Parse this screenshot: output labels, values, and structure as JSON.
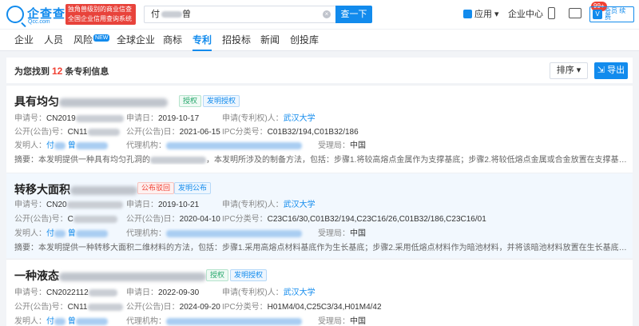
{
  "header": {
    "logo_text": "企查查",
    "logo_sub": "Qcc.com",
    "slogan": "独角兽级别的商业信查 全国企业信用查询系统",
    "search_value": "付",
    "search_value_tail": "曾",
    "search_button": "查一下",
    "app_label": "应用",
    "enterprise_center": "企业中心",
    "msg_badge": "99+",
    "vip_label": "会员 续费"
  },
  "nav": {
    "items": [
      "企业",
      "人员",
      "风险",
      "全球企业",
      "商标",
      "专利",
      "招投标",
      "新闻",
      "创投库"
    ],
    "risk_badge": "NEW",
    "active": "专利"
  },
  "results": {
    "prefix": "为您找到",
    "count": "12",
    "suffix": "条专利信息",
    "sort_label": "排序",
    "export_label": "导出"
  },
  "labels": {
    "app_no": "申请号：",
    "app_date": "申请日：",
    "applicant": "申请(专利权)人：",
    "pub_no": "公开(公告)号：",
    "pub_date": "公开(公告)日：",
    "ipc": "IPC分类号：",
    "inventor": "发明人：",
    "agency": "代理机构：",
    "office": "受理局：",
    "abstract": "摘要："
  },
  "patents": [
    {
      "title": "具有均匀",
      "status_tag": "授权",
      "type_tag": "发明授权",
      "app_no": "CN2019",
      "app_date": "2019-10-17",
      "applicant": "武汉大学",
      "pub_no": "CN11",
      "pub_date": "2021-06-15",
      "ipc": "C01B32/194,C01B32/186",
      "inventor_a": "付",
      "inventor_b": "曾",
      "office": "中国",
      "abstract_a": "本发明提供一种具有均匀孔洞的",
      "abstract_b": "，本发明所涉及的制备方法，包括：步骤1.将较高熔点金属作为支撑基底；步骤2.将较低熔点金属或合金放置在支撑基底上作为..."
    },
    {
      "title": "转移大面积",
      "status_tag": "公布驳回",
      "type_tag": "发明公布",
      "app_no": "CN20",
      "app_date": "2019-10-21",
      "applicant": "武汉大学",
      "pub_no": "C",
      "pub_date": "2020-04-10",
      "ipc": "C23C16/30,C01B32/194,C23C16/26,C01B32/186,C23C16/01",
      "inventor_a": "付",
      "inventor_b": "曾",
      "office": "中国",
      "abstract_a": "本发明提供一种转移大面积二维材料的方法，包括：步骤1.采用高熔点材料基底作为生长基底；步骤2.采用低熔点材料作为暗池材料，并将该暗池材料放置在生长基底上；步骤3.将高..."
    },
    {
      "title": "一种液态",
      "status_tag": "授权",
      "type_tag": "发明授权",
      "app_no": "CN2022112",
      "app_date": "2022-09-30",
      "applicant": "武汉大学",
      "pub_no": "CN11",
      "pub_date": "2024-09-20",
      "ipc": "H01M4/04,C25C3/34,H01M4/42",
      "inventor_a": "付",
      "inventor_b": "曾",
      "office": "中国"
    }
  ]
}
